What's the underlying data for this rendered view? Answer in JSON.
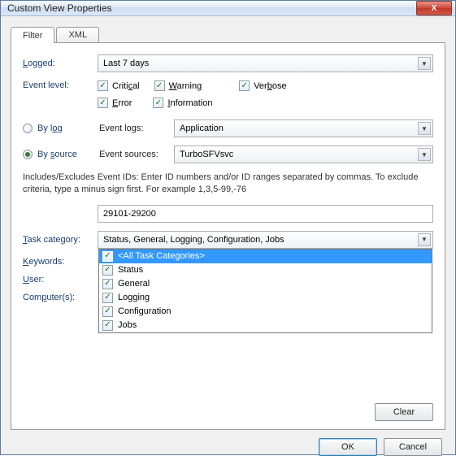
{
  "window": {
    "title": "Custom View Properties",
    "close": "X"
  },
  "tabs": {
    "filter": "Filter",
    "xml": "XML"
  },
  "labels": {
    "logged": "Logged:",
    "eventlevel": "Event level:",
    "bylog": "By log",
    "bysource": "By source",
    "eventlogs": "Event logs:",
    "eventsources": "Event sources:",
    "taskcategory": "Task category:",
    "keywords": "Keywords:",
    "user": "User:",
    "computers": "Computer(s):"
  },
  "logged": "Last 7 days",
  "levels": {
    "critical": "Critical",
    "warning": "Warning",
    "verbose": "Verbose",
    "error": "Error",
    "information": "Information"
  },
  "eventlogs": "Application",
  "eventsources": "TurboSFVsvc",
  "hint": "Includes/Excludes Event IDs: Enter ID numbers and/or ID ranges separated by commas. To exclude criteria, type a minus sign first. For example 1,3,5-99,-76",
  "eventids": "29101-29200",
  "taskcategory_value": "Status, General, Logging, Configuration, Jobs",
  "taskcategory_items": {
    "all": "<All Task Categories>",
    "status": "Status",
    "general": "General",
    "logging": "Logging",
    "configuration": "Configuration",
    "jobs": "Jobs"
  },
  "buttons": {
    "clear": "Clear",
    "ok": "OK",
    "cancel": "Cancel"
  },
  "check": "✓"
}
